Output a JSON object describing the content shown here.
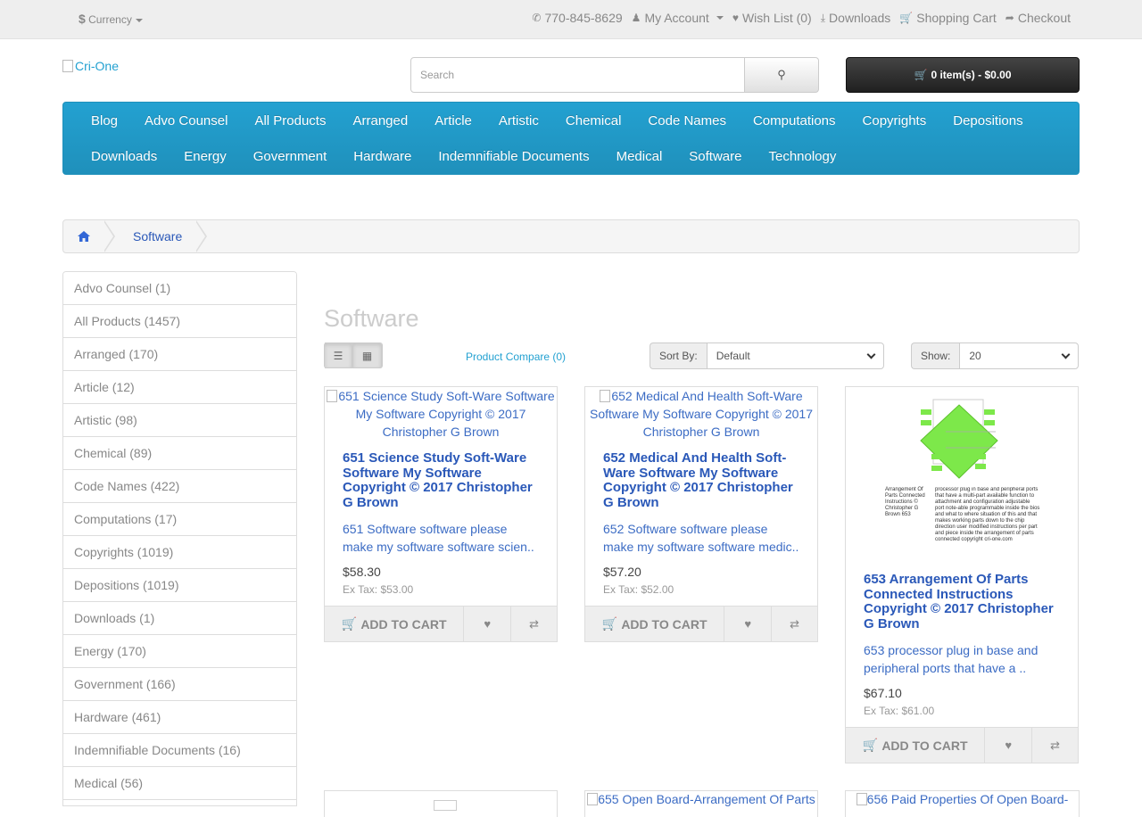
{
  "topbar": {
    "currency_symbol": "$",
    "currency_label": "Currency",
    "phone": "770-845-8629",
    "my_account": "My Account",
    "wish_list": "Wish List (0)",
    "downloads": "Downloads",
    "shopping_cart": "Shopping Cart",
    "checkout": "Checkout"
  },
  "header": {
    "logo_alt": "Cri-One",
    "search_placeholder": "Search",
    "cart_button": "0 item(s) - $0.00"
  },
  "menu": {
    "row1": [
      "Blog",
      "Advo Counsel",
      "All Products",
      "Arranged",
      "Article",
      "Artistic",
      "Chemical",
      "Code Names",
      "Computations",
      "Copyrights",
      "Depositions"
    ],
    "row2": [
      "Downloads",
      "Energy",
      "Government",
      "Hardware",
      "Indemnifiable Documents",
      "Medical",
      "Software",
      "Technology"
    ]
  },
  "breadcrumb": {
    "current": "Software"
  },
  "sidebar": {
    "items": [
      "Advo Counsel (1)",
      "All Products (1457)",
      "Arranged (170)",
      "Article (12)",
      "Artistic (98)",
      "Chemical (89)",
      "Code Names (422)",
      "Computations (17)",
      "Copyrights (1019)",
      "Depositions (1019)",
      "Downloads (1)",
      "Energy (170)",
      "Government (166)",
      "Hardware (461)",
      "Indemnifiable Documents (16)",
      "Medical (56)"
    ]
  },
  "content": {
    "title": "Software",
    "product_compare": "Product Compare (0)",
    "sort_label": "Sort By:",
    "sort_value": "Default",
    "show_label": "Show:",
    "show_value": "20",
    "add_to_cart": "ADD TO CART"
  },
  "products": [
    {
      "img_alt": "651 Science Study Soft-Ware Software My Software Copyright © 2017 Christopher G Brown",
      "name": "651 Science Study Soft-Ware Software My Software Copyright © 2017 Christopher G Brown",
      "desc": "651 Software software please make my software software scien..",
      "price": "$58.30",
      "ex_tax": "Ex Tax: $53.00"
    },
    {
      "img_alt": "652 Medical And Health Soft-Ware Software My Software Copyright © 2017 Christopher G Brown",
      "name": "652 Medical And Health Soft-Ware Software My Software Copyright © 2017 Christopher G Brown",
      "desc": "652 Software software please make my software software medic..",
      "price": "$57.20",
      "ex_tax": "Ex Tax: $52.00"
    },
    {
      "img_caption_left": "Arrangement Of Parts Connected Instructions © Christopher G Brown 653",
      "img_caption_right": "processor plug in base and peripheral ports that have a multi-part available function to attachment and configuration adjustable port note-able programmable inside the bios and what to where situation of this and that makes working parts down to the chip direction user modified instructions per part and piece inside the arrangement of parts connected copyright cri-one.com",
      "name": "653 Arrangement Of Parts Connected Instructions Copyright © 2017 Christopher G Brown",
      "desc": "653 processor plug in base and peripheral ports that have a ..",
      "price": "$67.10",
      "ex_tax": "Ex Tax: $61.00"
    }
  ],
  "partial_products": [
    {
      "img_alt": ""
    },
    {
      "img_alt": "655 Open Board-Arrangement Of Parts"
    },
    {
      "img_alt": "656 Paid Properties Of Open Board-"
    }
  ],
  "colors": {
    "menu_bg": "#23a1d1",
    "link": "#2a58b8",
    "cart_button_bg": "#303030"
  }
}
